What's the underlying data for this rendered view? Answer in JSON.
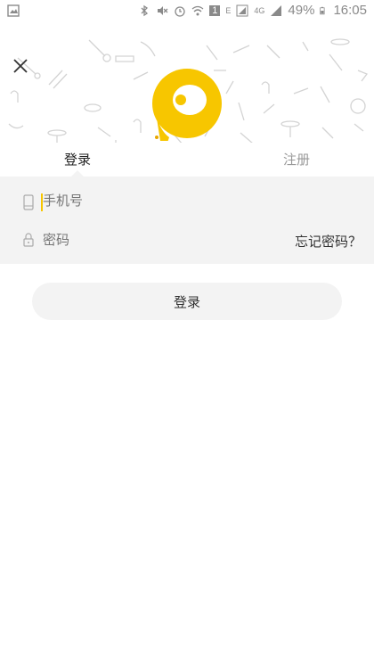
{
  "status_bar": {
    "battery_percent": "49%",
    "time": "16:05",
    "network": "4G",
    "sim": "1",
    "signal_label": "E",
    "icons": [
      "image-icon",
      "bluetooth-icon",
      "mute-icon",
      "alarm-icon",
      "wifi-icon",
      "sim-icon",
      "signal-icon",
      "battery-icon"
    ]
  },
  "header": {
    "close_icon": "close-icon",
    "logo_icon": "app-logo",
    "brand_color": "#f7c600"
  },
  "tabs": {
    "login": "登录",
    "register": "注册",
    "active": "login"
  },
  "form": {
    "phone_placeholder": "手机号",
    "password_placeholder": "密码",
    "forgot_password": "忘记密码？",
    "phone_icon": "phone-icon",
    "lock_icon": "lock-icon"
  },
  "login_button": "登录"
}
